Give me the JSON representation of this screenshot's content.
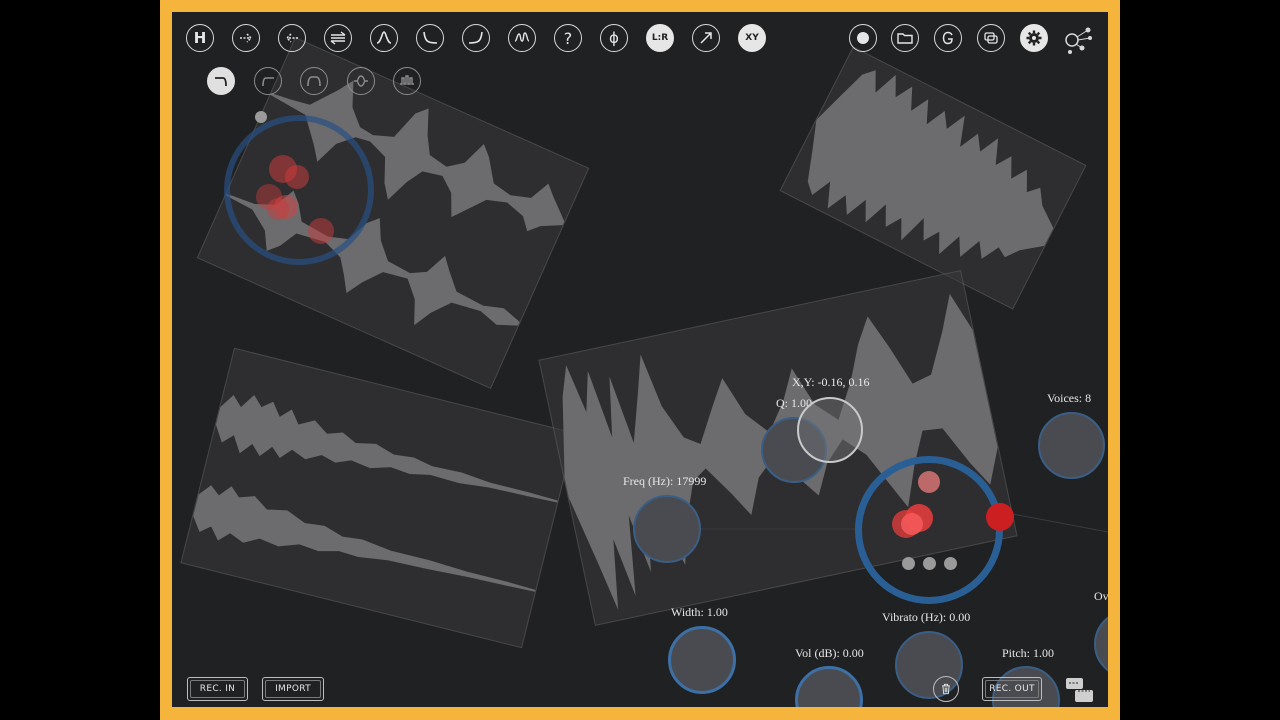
{
  "toolbar": {
    "left_buttons": [
      {
        "name": "help-button",
        "glyph": "H"
      },
      {
        "name": "forward-button",
        "glyph": ""
      },
      {
        "name": "reverse-button",
        "glyph": ""
      },
      {
        "name": "bidirectional-button",
        "glyph": ""
      },
      {
        "name": "bandpass-filter-button",
        "glyph": ""
      },
      {
        "name": "lowshelf-button",
        "glyph": ""
      },
      {
        "name": "highshelf-button",
        "glyph": ""
      },
      {
        "name": "formant-button",
        "glyph": ""
      },
      {
        "name": "random-button",
        "glyph": "?"
      },
      {
        "name": "phase-button",
        "glyph": "ϕ"
      },
      {
        "name": "stereo-button",
        "glyph": "L:R"
      },
      {
        "name": "direction-button",
        "glyph": ""
      },
      {
        "name": "xy-button",
        "glyph": "XY"
      }
    ],
    "right_buttons": [
      "record-button",
      "folder-button",
      "grain-mode-button",
      "layers-button",
      "settings-button",
      "network-button"
    ]
  },
  "filters": [
    "lowpass-filter-button",
    "highpass-filter-button",
    "bandpass-shape-button",
    "notch-filter-button",
    "comb-filter-button"
  ],
  "params": {
    "xy": "X,Y: -0.16, 0.16",
    "q": "Q: 1.00",
    "voices": "Voices:  8",
    "freq": "Freq (Hz): 17999",
    "width": "Width: 1.00",
    "vibrato": "Vibrato (Hz): 0.00",
    "vol": "Vol (dB): 0.00",
    "pitch": "Pitch: 1.00",
    "overflow": "Ov"
  },
  "buttons": {
    "rec_in": "REC. IN",
    "import": "IMPORT",
    "rec_out": "REC. OUT"
  },
  "colors": {
    "frame": "#f5b43c",
    "background": "#202122",
    "accent_blue": "#2a5f96",
    "grain_red": "#e23a3a"
  }
}
